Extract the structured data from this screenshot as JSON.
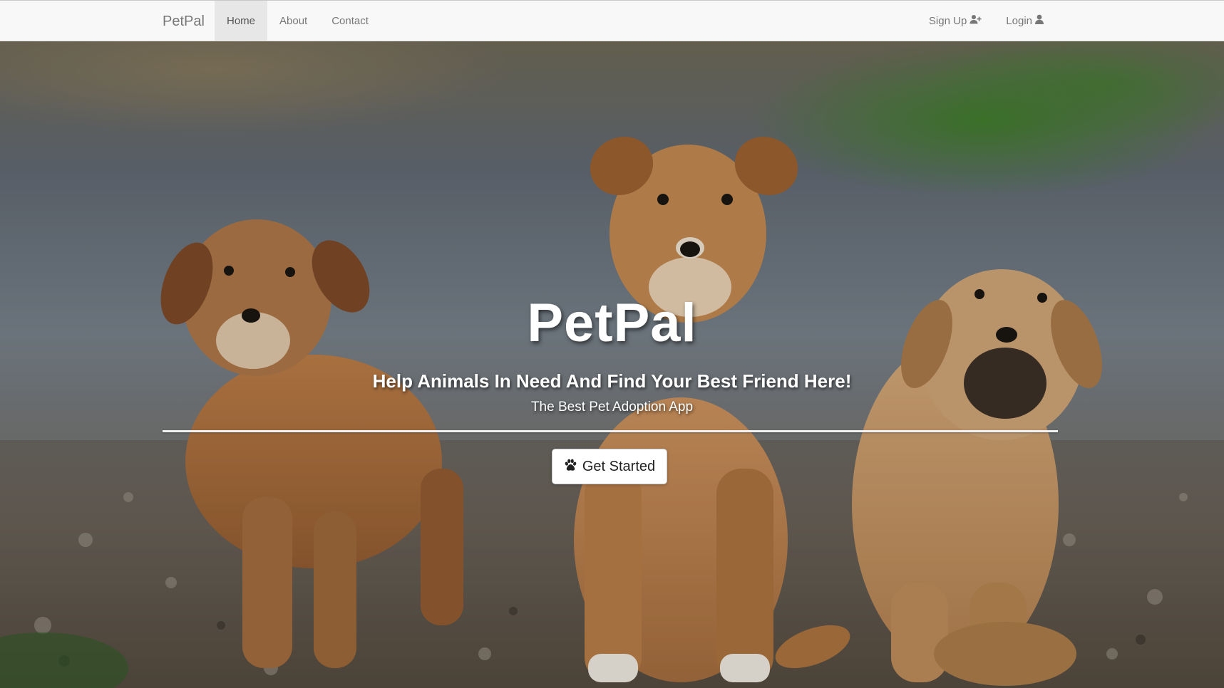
{
  "navbar": {
    "brand": "PetPal",
    "left_links": [
      {
        "label": "Home",
        "active": true
      },
      {
        "label": "About",
        "active": false
      },
      {
        "label": "Contact",
        "active": false
      }
    ],
    "right_links": [
      {
        "label": "Sign Up",
        "icon": "user-plus-icon"
      },
      {
        "label": "Login",
        "icon": "user-icon"
      }
    ]
  },
  "hero": {
    "title": "PetPal",
    "subtitle": "Help Animals In Need And Find Your Best Friend Here!",
    "tagline": "The Best Pet Adoption App",
    "cta_label": "Get Started",
    "cta_icon": "paw-icon",
    "background": "photo of three brown puppies on gravel"
  },
  "colors": {
    "navbar_bg": "#f8f8f8",
    "nav_active_bg": "#e7e7e7",
    "nav_text": "#777777",
    "hero_text": "#ffffff",
    "button_bg": "#ffffff"
  }
}
